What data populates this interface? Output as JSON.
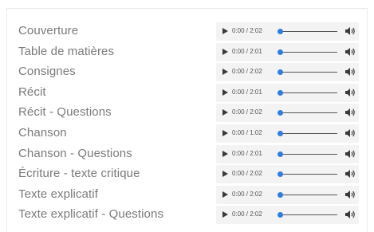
{
  "tracks": [
    {
      "title": "Couverture",
      "time": "0:00 / 2:02",
      "progress": 0
    },
    {
      "title": "Table de matières",
      "time": "0:00 / 2:01",
      "progress": 0
    },
    {
      "title": "Consignes",
      "time": "0:00 / 2:02",
      "progress": 0
    },
    {
      "title": "Récit",
      "time": "0:00 / 2:01",
      "progress": 0
    },
    {
      "title": "Récit - Questions",
      "time": "0:00 / 2:02",
      "progress": 0
    },
    {
      "title": "Chanson",
      "time": "0:00 / 1:02",
      "progress": 0
    },
    {
      "title": "Chanson - Questions",
      "time": "0:00 / 2:01",
      "progress": 0
    },
    {
      "title": "Écriture - texte critique",
      "time": "0:00 / 2:02",
      "progress": 0
    },
    {
      "title": "Texte explicatif",
      "time": "0:00 / 2:02",
      "progress": 0
    },
    {
      "title": "Texte explicatif - Questions",
      "time": "0:00 / 2:02",
      "progress": 0
    }
  ],
  "icons": {
    "play": "play-icon",
    "volume": "volume-icon"
  },
  "colors": {
    "title_text": "#7a7a7a",
    "player_bg": "#f3f3f3",
    "accent": "#2f7de1",
    "icon": "#3a3a3a"
  }
}
